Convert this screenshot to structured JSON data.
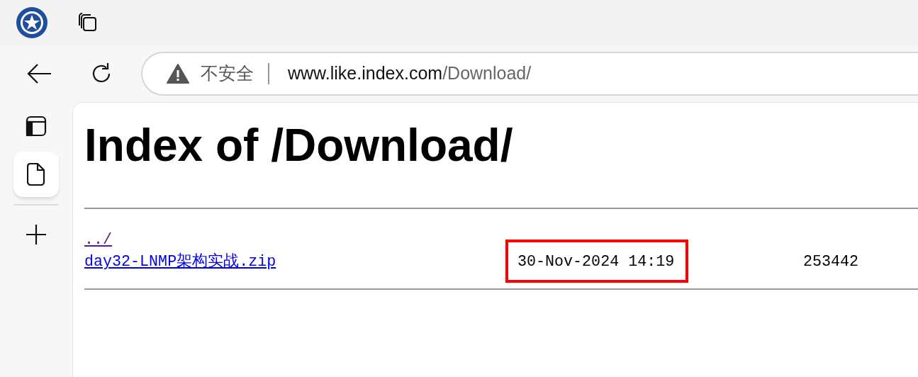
{
  "browser": {
    "security_label": "不安全",
    "url": {
      "host": "www.like.index.com",
      "path": "/Download/"
    }
  },
  "sidebar": {
    "items": [
      {
        "kind": "panel",
        "selected": false
      },
      {
        "kind": "page",
        "selected": true
      }
    ]
  },
  "page": {
    "title": "Index of /Download/",
    "entries": [
      {
        "name": "../",
        "visited": true
      },
      {
        "name": "day32-LNMP架构实战.zip",
        "visited": false,
        "date": "30-Nov-2024 14:19",
        "size": "253442",
        "highlighted": true
      }
    ]
  }
}
